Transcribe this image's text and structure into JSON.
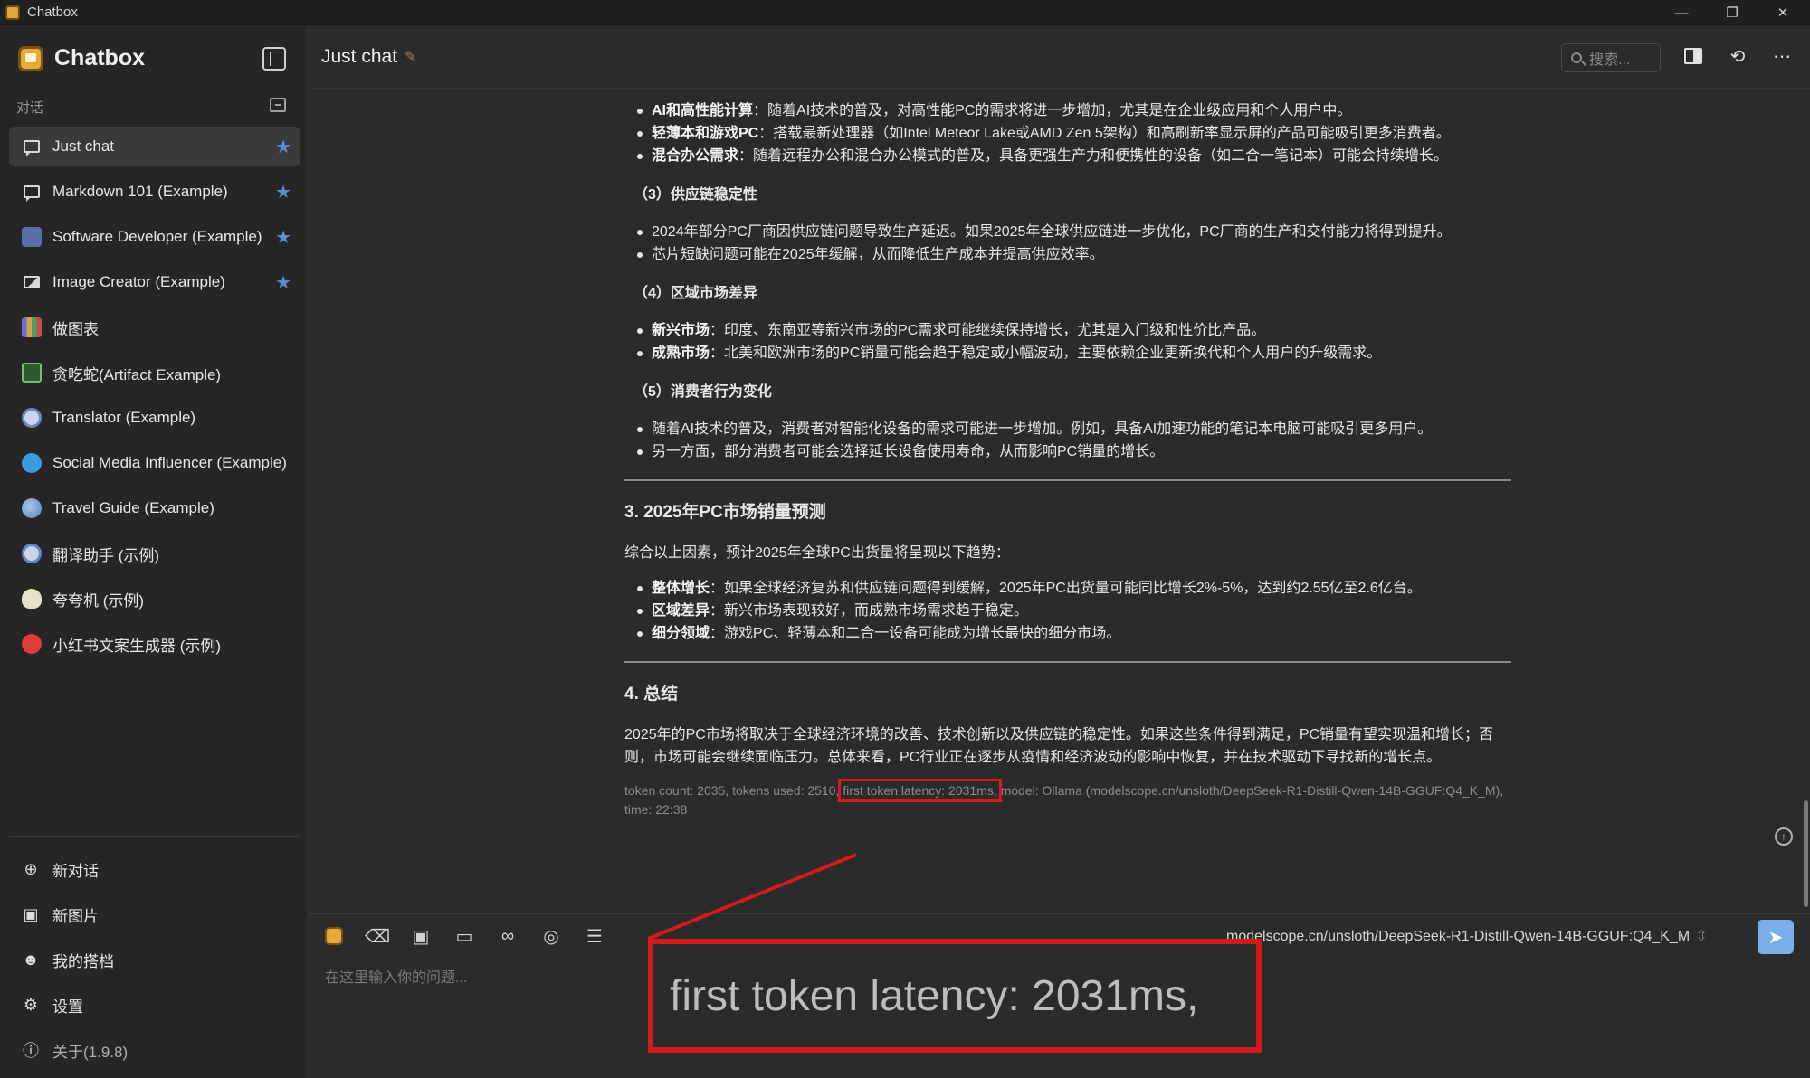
{
  "window": {
    "title": "Chatbox",
    "controls": [
      "—",
      "❐",
      "✕"
    ]
  },
  "sidebar": {
    "brand": "Chatbox",
    "section_label": "对话",
    "sessions": [
      {
        "label": "Just chat",
        "starred": true,
        "active": true,
        "icon": "chat-bubble-icon"
      },
      {
        "label": "Markdown 101 (Example)",
        "starred": true,
        "icon": "chat-bubble-icon"
      },
      {
        "label": "Software Developer (Example)",
        "starred": true,
        "icon": "developer-avatar-icon"
      },
      {
        "label": "Image Creator (Example)",
        "starred": true,
        "icon": "image-icon"
      },
      {
        "label": "做图表",
        "starred": false,
        "icon": "chart-avatar-icon"
      },
      {
        "label": "贪吃蛇(Artifact Example)",
        "starred": false,
        "icon": "snake-avatar-icon"
      },
      {
        "label": "Translator (Example)",
        "starred": false,
        "icon": "translator-avatar-icon"
      },
      {
        "label": "Social Media Influencer (Example)",
        "starred": false,
        "icon": "twitter-avatar-icon"
      },
      {
        "label": "Travel Guide (Example)",
        "starred": false,
        "icon": "globe-avatar-icon"
      },
      {
        "label": "翻译助手 (示例)",
        "starred": false,
        "icon": "translator-avatar-icon"
      },
      {
        "label": "夸夸机 (示例)",
        "starred": false,
        "icon": "bird-avatar-icon"
      },
      {
        "label": "小红书文案生成器 (示例)",
        "starred": false,
        "icon": "xiaohongshu-avatar-icon"
      }
    ],
    "actions": [
      {
        "label": "新对话",
        "icon": "plus-circle-icon"
      },
      {
        "label": "新图片",
        "icon": "image-add-icon"
      },
      {
        "label": "我的搭档",
        "icon": "partner-icon"
      },
      {
        "label": "设置",
        "icon": "gear-icon"
      },
      {
        "label": "关于(1.9.8)",
        "icon": "info-icon"
      }
    ]
  },
  "header": {
    "title": "Just chat",
    "search_placeholder": "搜索..."
  },
  "message": {
    "bullets_a": [
      {
        "bold": "AI和高性能计算",
        "text": "：随着AI技术的普及，对高性能PC的需求将进一步增加，尤其是在企业级应用和个人用户中。"
      },
      {
        "bold": "轻薄本和游戏PC",
        "text": "：搭载最新处理器（如Intel Meteor Lake或AMD Zen 5架构）和高刷新率显示屏的产品可能吸引更多消费者。"
      },
      {
        "bold": "混合办公需求",
        "text": "：随着远程办公和混合办公模式的普及，具备更强生产力和便携性的设备（如二合一笔记本）可能会持续增长。"
      }
    ],
    "sub3": "（3）供应链稳定性",
    "bullets_b": [
      {
        "bold": "",
        "text": "2024年部分PC厂商因供应链问题导致生产延迟。如果2025年全球供应链进一步优化，PC厂商的生产和交付能力将得到提升。"
      },
      {
        "bold": "",
        "text": "芯片短缺问题可能在2025年缓解，从而降低生产成本并提高供应效率。"
      }
    ],
    "sub4": "（4）区域市场差异",
    "bullets_c": [
      {
        "bold": "新兴市场",
        "text": "：印度、东南亚等新兴市场的PC需求可能继续保持增长，尤其是入门级和性价比产品。"
      },
      {
        "bold": "成熟市场",
        "text": "：北美和欧洲市场的PC销量可能会趋于稳定或小幅波动，主要依赖企业更新换代和个人用户的升级需求。"
      }
    ],
    "sub5": "（5）消费者行为变化",
    "bullets_d": [
      {
        "bold": "",
        "text": "随着AI技术的普及，消费者对智能化设备的需求可能进一步增加。例如，具备AI加速功能的笔记本电脑可能吸引更多用户。"
      },
      {
        "bold": "",
        "text": "另一方面，部分消费者可能会选择延长设备使用寿命，从而影响PC销量的增长。"
      }
    ],
    "h3_forecast": "3. 2025年PC市场销量预测",
    "forecast_intro": "综合以上因素，预计2025年全球PC出货量将呈现以下趋势：",
    "bullets_e": [
      {
        "bold": "整体增长",
        "text": "：如果全球经济复苏和供应链问题得到缓解，2025年PC出货量可能同比增长2%-5%，达到约2.55亿至2.6亿台。"
      },
      {
        "bold": "区域差异",
        "text": "：新兴市场表现较好，而成熟市场需求趋于稳定。"
      },
      {
        "bold": "细分领域",
        "text": "：游戏PC、轻薄本和二合一设备可能成为增长最快的细分市场。"
      }
    ],
    "h3_summary": "4. 总结",
    "summary": "2025年的PC市场将取决于全球经济环境的改善、技术创新以及供应链的稳定性。如果这些条件得到满足，PC销量有望实现温和增长；否则，市场可能会继续面临压力。总体来看，PC行业正在逐步从疫情和经济波动的影响中恢复，并在技术驱动下寻找新的增长点。",
    "meta_before": "token count: 2035, tokens used: 2510, ",
    "meta_highlight": "first token latency: 2031ms,",
    "meta_after": " model: Ollama (modelscope.cn/unsloth/DeepSeek-R1-Distill-Qwen-14B-GGUF:Q4_K_M), time: 22:38"
  },
  "input": {
    "placeholder": "在这里输入你的问题...",
    "model": "modelscope.cn/unsloth/DeepSeek-R1-Distill-Qwen-14B-GGUF:Q4_K_M"
  },
  "zoom_callout": "first token latency: 2031ms,",
  "colors": {
    "accent": "#7aaee6",
    "highlight": "#d21b1b",
    "star": "#5b8fd6"
  }
}
